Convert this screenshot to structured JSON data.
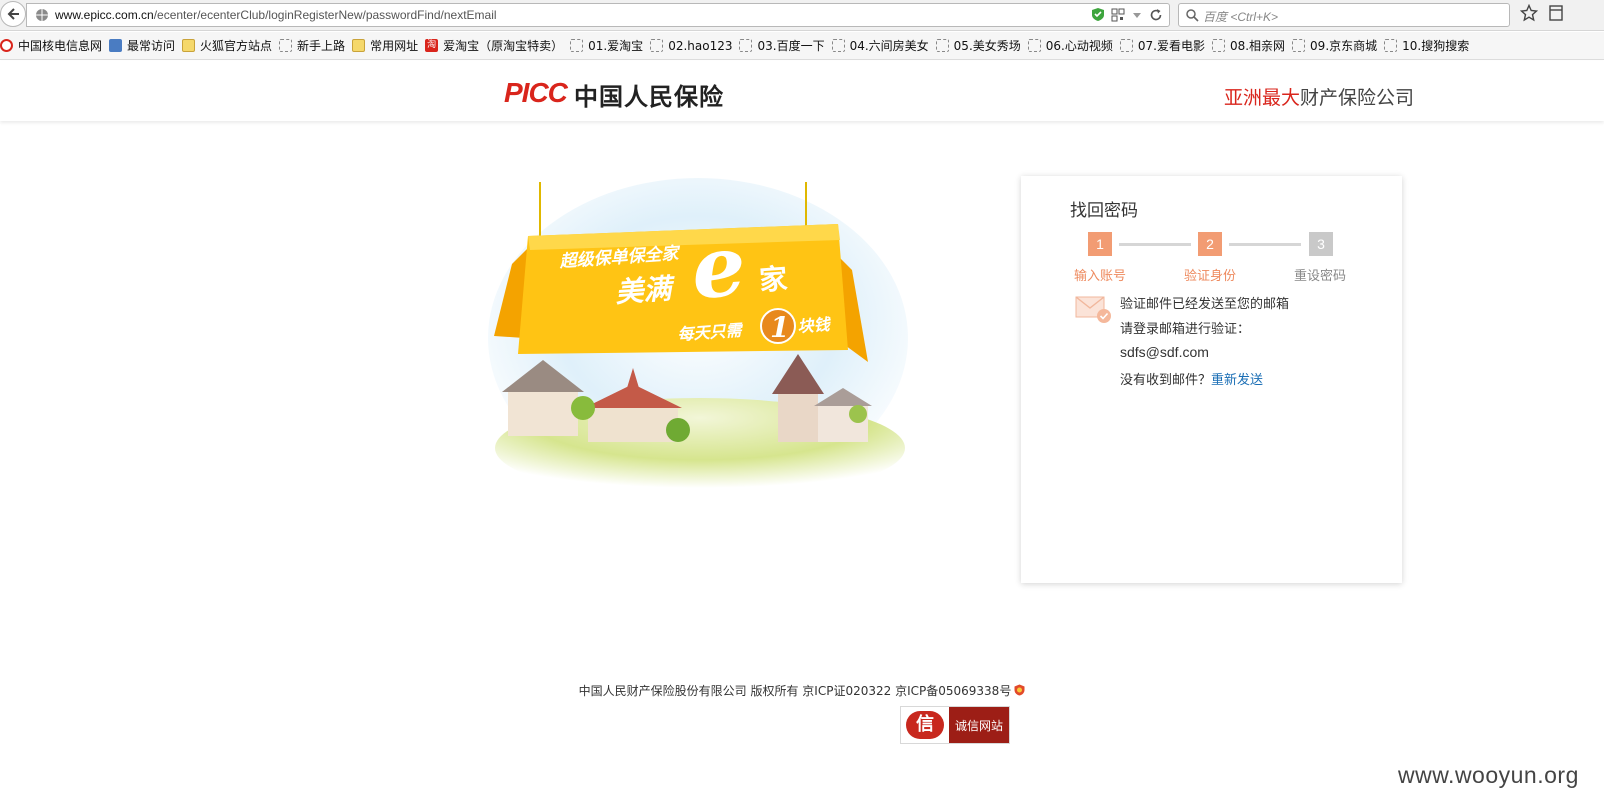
{
  "browser": {
    "url_host": "www.epicc.com.cn",
    "url_path": "/ecenter/ecenterClub/loginRegisterNew/passwordFind/nextEmail",
    "search_placeholder": "百度 <Ctrl+K>",
    "bookmarks": [
      {
        "label": "中国核电信息网",
        "icon": "picc"
      },
      {
        "label": "最常访问",
        "icon": "blue"
      },
      {
        "label": "火狐官方站点",
        "icon": "folder"
      },
      {
        "label": "新手上路",
        "icon": "dashed"
      },
      {
        "label": "常用网址",
        "icon": "folder"
      },
      {
        "label": "爱淘宝（原淘宝特卖）",
        "icon": "red"
      },
      {
        "label": "01.爱淘宝",
        "icon": "dashed"
      },
      {
        "label": "02.hao123",
        "icon": "dashed"
      },
      {
        "label": "03.百度一下",
        "icon": "dashed"
      },
      {
        "label": "04.六间房美女",
        "icon": "dashed"
      },
      {
        "label": "05.美女秀场",
        "icon": "dashed"
      },
      {
        "label": "06.心动视频",
        "icon": "dashed"
      },
      {
        "label": "07.爱看电影",
        "icon": "dashed"
      },
      {
        "label": "08.相亲网",
        "icon": "dashed"
      },
      {
        "label": "09.京东商城",
        "icon": "dashed"
      },
      {
        "label": "10.搜狗搜索",
        "icon": "dashed"
      }
    ],
    "taobao_glyph": "淘"
  },
  "header": {
    "logo_en": "PICC",
    "logo_cn": "中国人民保险",
    "slogan_highlight": "亚洲最大",
    "slogan_rest": "财产保险公司"
  },
  "banner": {
    "line1": "超级保单保全家",
    "line2": "美满",
    "big_e": "e",
    "line3": "家",
    "line4_a": "每天只需",
    "line4_num": "1",
    "line4_b": "块钱"
  },
  "card": {
    "title": "找回密码",
    "steps": [
      {
        "num": "1",
        "label": "输入账号",
        "state": "done"
      },
      {
        "num": "2",
        "label": "验证身份",
        "state": "done"
      },
      {
        "num": "3",
        "label": "重设密码",
        "state": "todo"
      }
    ],
    "message_line1": "验证邮件已经发送至您的邮箱",
    "message_line2": "请登录邮箱进行验证：",
    "email": "sdfs@sdf.com",
    "no_mail_text": "没有收到邮件？",
    "resend_label": "重新发送"
  },
  "footer": {
    "copyright": "中国人民财产保险股份有限公司 版权所有 京ICP证020322 京ICP备05069338号",
    "trust_seal": "信",
    "trust_label": "诚信网站"
  },
  "watermark": "www.wooyun.org",
  "colors": {
    "brand_red": "#d9251c",
    "step_active": "#f29c73",
    "step_inactive": "#c9c9c9",
    "link_blue": "#1a6eb5"
  }
}
